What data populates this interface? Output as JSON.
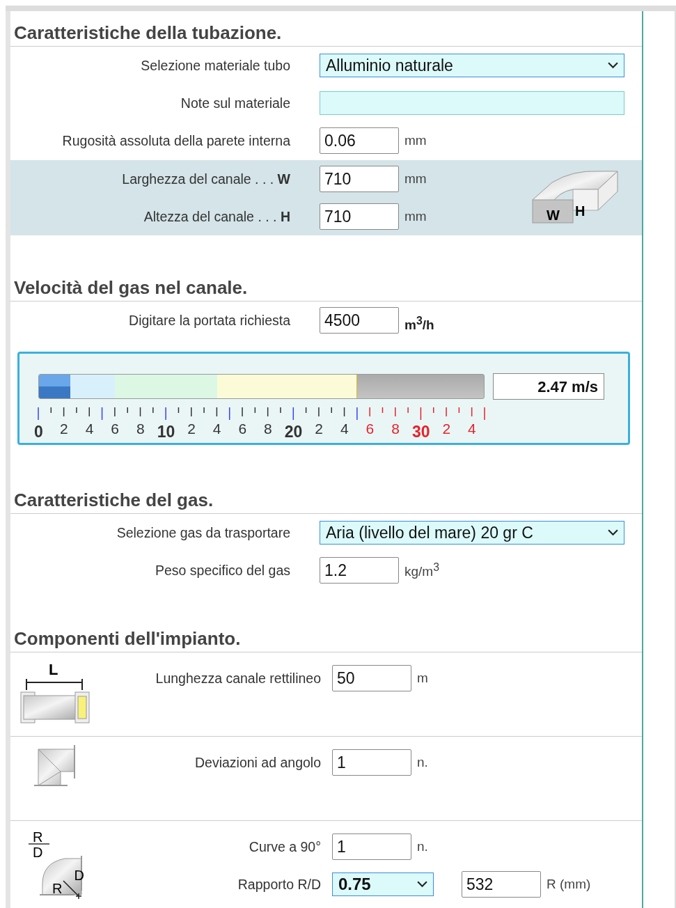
{
  "pipe": {
    "title": "Caratteristiche della tubazione.",
    "rows": [
      {
        "kind": "select",
        "label": "Selezione materiale tubo",
        "value": "Alluminio naturale"
      },
      {
        "kind": "blank",
        "label": "Note sul materiale"
      },
      {
        "kind": "number",
        "label": "Rugosità assoluta della parete interna",
        "value": "0.06",
        "unit": "mm"
      }
    ]
  },
  "dimensions": {
    "rows": [
      {
        "label": "Larghezza del canale . . . **W**",
        "value": "710",
        "unit": "mm"
      },
      {
        "label": "Altezza del canale . . . **H**",
        "value": "710",
        "unit": "mm"
      }
    ],
    "marks": [
      "W",
      "H"
    ]
  },
  "velocity": {
    "title": "Velocità del gas nel canale.",
    "flow": {
      "label": "Digitare la portata richiesta",
      "value": "4500",
      "unit": "m$^{3}$/h"
    },
    "meter": {
      "level": 0.0706,
      "reading": "2.47 m/s",
      "scale": [
        {
          "text": "0",
          "major": true,
          "alert": false
        },
        {
          "text": "2",
          "major": false,
          "alert": false
        },
        {
          "text": "4",
          "major": false,
          "alert": false
        },
        {
          "text": "6",
          "major": false,
          "alert": false
        },
        {
          "text": "8",
          "major": false,
          "alert": false
        },
        {
          "text": "10",
          "major": true,
          "alert": false
        },
        {
          "text": "2",
          "major": false,
          "alert": false
        },
        {
          "text": "4",
          "major": false,
          "alert": false
        },
        {
          "text": "6",
          "major": false,
          "alert": false
        },
        {
          "text": "8",
          "major": false,
          "alert": false
        },
        {
          "text": "20",
          "major": true,
          "alert": false
        },
        {
          "text": "2",
          "major": false,
          "alert": false
        },
        {
          "text": "4",
          "major": false,
          "alert": false
        },
        {
          "text": "6",
          "major": false,
          "alert": true
        },
        {
          "text": "8",
          "major": false,
          "alert": true
        },
        {
          "text": "30",
          "major": true,
          "alert": true
        },
        {
          "text": "2",
          "major": false,
          "alert": true
        },
        {
          "text": "4",
          "major": false,
          "alert": true
        }
      ]
    }
  },
  "gas": {
    "title": "Caratteristiche del gas.",
    "rows": [
      {
        "kind": "select",
        "label": "Selezione gas da trasportare",
        "value": "Aria (livello del mare) 20 gr C"
      },
      {
        "kind": "number",
        "label": "Peso specifico del gas",
        "value": "1.2",
        "unit": "kg/m$^{3}$"
      }
    ]
  },
  "components": {
    "title": "Componenti dell'impianto.",
    "groups": [
      {
        "kind": "straight",
        "marks": [
          "L"
        ],
        "rows": [
          {
            "kind": "number",
            "label": "Lunghezza canale rettilineo",
            "value": "50",
            "unit": "m"
          }
        ]
      },
      {
        "kind": "elbow",
        "rows": [
          {
            "kind": "number",
            "label": "Deviazioni ad angolo",
            "value": "1",
            "unit": "n."
          }
        ]
      },
      {
        "kind": "bend",
        "marks": [
          "R",
          "D",
          "D",
          "R"
        ],
        "rows": [
          {
            "kind": "number",
            "label": "Curve a 90°",
            "value": "1",
            "unit": "n."
          },
          {
            "kind": "ratio",
            "label": "Rapporto R/D",
            "value": "0.75",
            "extra": "532",
            "unit": "R (mm)"
          }
        ]
      }
    ]
  }
}
